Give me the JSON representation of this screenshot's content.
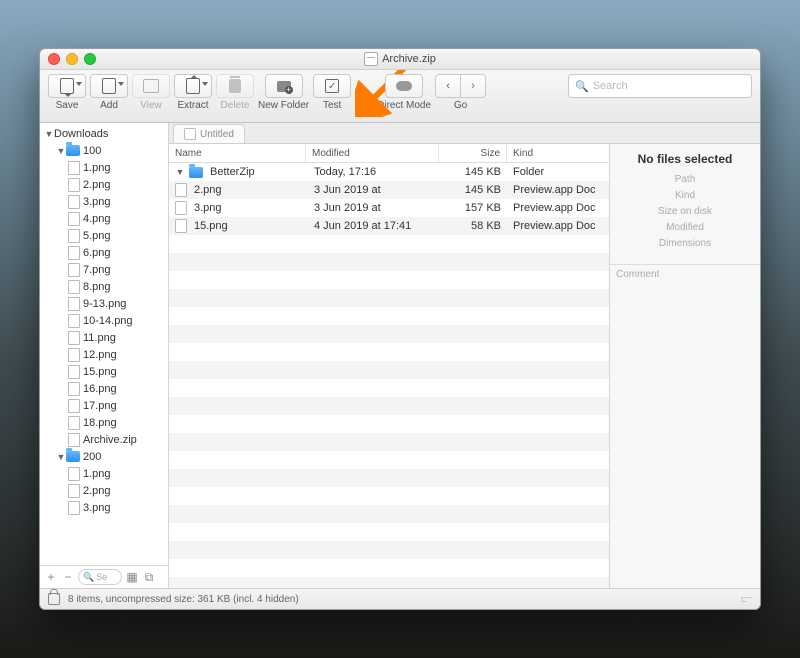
{
  "title": "Archive.zip",
  "toolbar": {
    "save": "Save",
    "add": "Add",
    "view": "View",
    "extract": "Extract",
    "delete": "Delete",
    "newfolder": "New Folder",
    "test": "Test",
    "direct": "Direct Mode",
    "go": "Go",
    "search_placeholder": "Search"
  },
  "sidebar": {
    "root": "Downloads",
    "folder1": "100",
    "f1items": [
      "1.png",
      "2.png",
      "3.png",
      "4.png",
      "5.png",
      "6.png",
      "7.png",
      "8.png",
      "9-13.png",
      "10-14.png",
      "11.png",
      "12.png",
      "15.png",
      "16.png",
      "17.png",
      "18.png",
      "Archive.zip"
    ],
    "folder2": "200",
    "f2items": [
      "1.png",
      "2.png",
      "3.png"
    ],
    "search_placeholder": "Se"
  },
  "tab": "Untitled",
  "columns": {
    "name": "Name",
    "modified": "Modified",
    "size": "Size",
    "kind": "Kind"
  },
  "rows": [
    {
      "name": "BetterZip",
      "modified": "Today, 17:16",
      "size": "145 KB",
      "kind": "Folder",
      "folder": true
    },
    {
      "name": "2.png",
      "modified": "3 Jun 2019 at",
      "size": "145 KB",
      "kind": "Preview.app Doc"
    },
    {
      "name": "3.png",
      "modified": "3 Jun 2019 at",
      "size": "157 KB",
      "kind": "Preview.app Doc"
    },
    {
      "name": "15.png",
      "modified": "4 Jun 2019 at 17:41",
      "size": "58 KB",
      "kind": "Preview.app Doc"
    }
  ],
  "inspector": {
    "heading": "No files selected",
    "labels": [
      "Path",
      "Kind",
      "Size on disk",
      "Modified",
      "Dimensions"
    ],
    "comment": "Comment"
  },
  "status": "8 items, uncompressed size: 361 KB (incl. 4 hidden)"
}
